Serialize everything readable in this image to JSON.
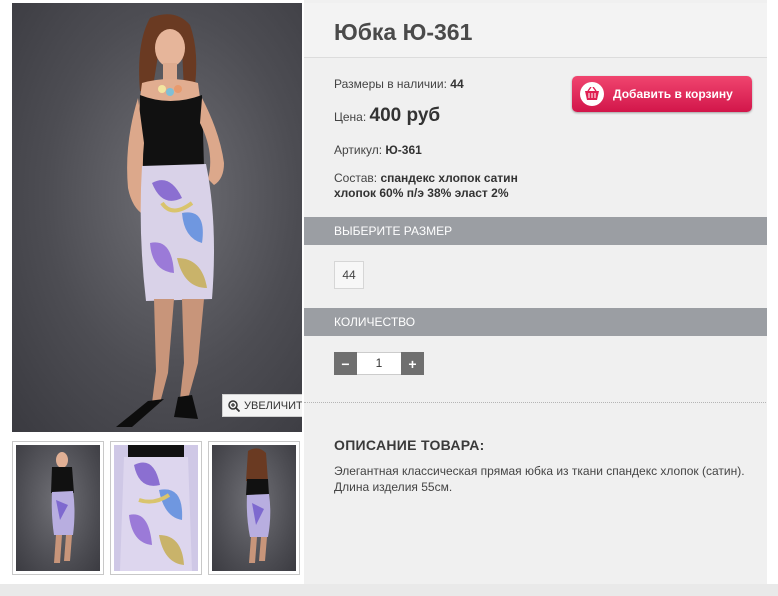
{
  "product": {
    "title": "Юбка Ю-361",
    "sizes_label": "Размеры в наличии:",
    "sizes_value": "44",
    "price_label": "Цена:",
    "price_value": "400 руб",
    "article_label": "Артикул:",
    "article_value": "Ю-361",
    "composition_label": "Состав:",
    "composition_line1": "спандекс хлопок сатин",
    "composition_line2": "хлопок 60% п/э 38% эласт 2%"
  },
  "cart_button": {
    "label": "Добавить в корзину",
    "icon": "basket-icon"
  },
  "zoom_button": {
    "label": "УВЕЛИЧИТЬ",
    "icon": "zoom-in-icon"
  },
  "size_section": {
    "heading": "ВЫБЕРИТЕ РАЗМЕР",
    "options": [
      "44"
    ]
  },
  "quantity_section": {
    "heading": "КОЛИЧЕСТВО",
    "minus": "−",
    "value": "1",
    "plus": "+"
  },
  "description": {
    "heading": "ОПИСАНИЕ ТОВАРА:",
    "text": "Элегантная классическая прямая юбка из ткани спандекс хлопок (сатин). Длина изделия 55см."
  },
  "colors": {
    "cart": "#e01f52",
    "section": "#9b9ea3",
    "qty_btn": "#6f6f6f"
  }
}
